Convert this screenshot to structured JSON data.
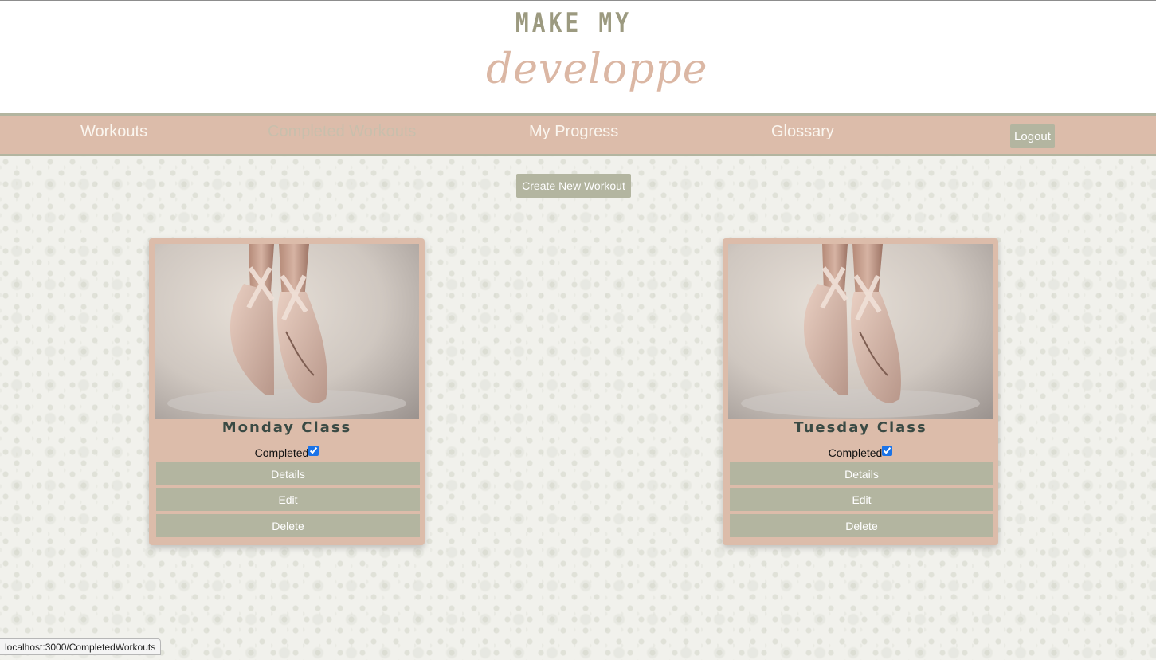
{
  "logo": {
    "line1": "MAKE MY",
    "line2": "developpe"
  },
  "nav": {
    "items": [
      {
        "label": "Workouts",
        "active": false
      },
      {
        "label": "Completed Workouts",
        "active": true
      },
      {
        "label": "My Progress",
        "active": false
      },
      {
        "label": "Glossary",
        "active": false
      }
    ],
    "logout_label": "Logout"
  },
  "create_button_label": "Create New Workout",
  "cards": [
    {
      "title": "Monday Class",
      "completed_label": "Completed",
      "completed": true,
      "image": "ballet-pointe-shoes-photo",
      "buttons": [
        "Details",
        "Edit",
        "Delete"
      ]
    },
    {
      "title": "Tuesday Class",
      "completed_label": "Completed",
      "completed": true,
      "image": "ballet-pointe-shoes-photo",
      "buttons": [
        "Details",
        "Edit",
        "Delete"
      ]
    }
  ],
  "status_bar": {
    "url": "localhost:3000/CompletedWorkouts"
  },
  "colors": {
    "nav_background": "#dcbcaa",
    "button_background": "#b3b5a0",
    "logo_primary": "#9c9a80",
    "logo_script": "#dbb7a4",
    "card_title": "#3a4a44"
  }
}
